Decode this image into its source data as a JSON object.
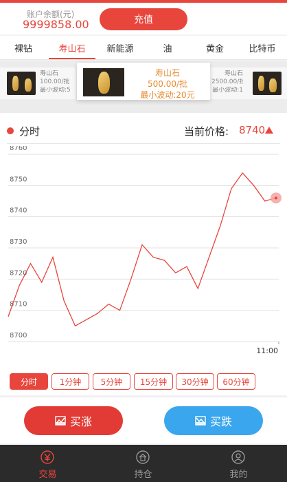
{
  "account": {
    "balance_label": "账户余额(元)",
    "balance_value": "9999858.00",
    "recharge_label": "充值"
  },
  "tabs": [
    "裸钻",
    "寿山石",
    "新能源",
    "油",
    "黄金",
    "比特币"
  ],
  "active_tab": 1,
  "products": {
    "left": {
      "name": "寿山石",
      "price": "100.00/批",
      "wave": "最小波动:5"
    },
    "active": {
      "name": "寿山石",
      "price": "500.00/批",
      "wave": "最小波动:20元"
    },
    "right": {
      "name": "寿山石",
      "price": "2500.00/批",
      "wave": "最小波动:1"
    }
  },
  "chart_header": {
    "title": "分时",
    "price_label": "当前价格:",
    "price_value": "8740"
  },
  "chart_data": {
    "type": "line",
    "title": "分时",
    "xlabel": "",
    "ylabel": "",
    "ylim": [
      8700,
      8760
    ],
    "yticks": [
      8700,
      8710,
      8720,
      8730,
      8740,
      8750,
      8760
    ],
    "x_end_label": "11:00",
    "series": [
      {
        "values": [
          8708,
          8718,
          8725,
          8719,
          8727,
          8713,
          8705,
          8707,
          8709,
          8712,
          8710,
          8720,
          8731,
          8727,
          8726,
          8722,
          8724,
          8717,
          8727,
          8737,
          8749,
          8754,
          8750,
          8745,
          8746
        ],
        "color": "#e8463c"
      }
    ],
    "last_point_marker": true,
    "grid": true
  },
  "periods": [
    "分时",
    "1分钟",
    "5分钟",
    "15分钟",
    "30分钟",
    "60分钟"
  ],
  "active_period": 0,
  "trade": {
    "buy_label": "买涨",
    "sell_label": "买跌"
  },
  "nav": [
    {
      "label": "交易",
      "icon": "yen-icon"
    },
    {
      "label": "持仓",
      "icon": "house-icon"
    },
    {
      "label": "我的",
      "icon": "user-icon"
    }
  ],
  "colors": {
    "accent": "#e8463c",
    "sell": "#3aa6ee",
    "product_text": "#e68a2e",
    "nav_bg": "#2b2b2b"
  }
}
